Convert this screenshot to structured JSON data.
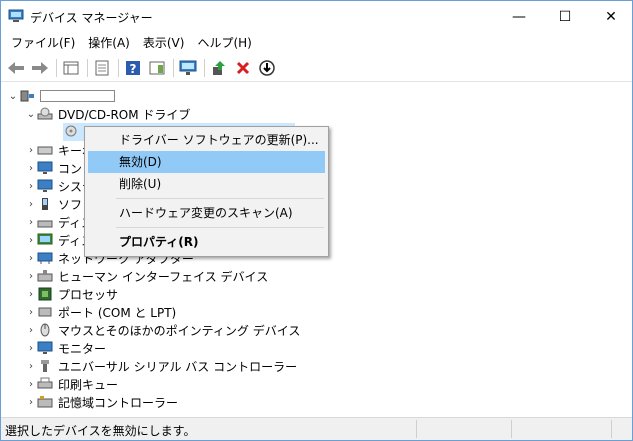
{
  "window": {
    "title": "デバイス マネージャー"
  },
  "window_buttons": {
    "minimize": "—",
    "maximize": "☐",
    "close": "✕"
  },
  "menu": [
    "ファイル(F)",
    "操作(A)",
    "表示(V)",
    "ヘルプ(H)"
  ],
  "tree": {
    "computer_name": "",
    "dvd_category": "DVD/CD-ROM ドライブ",
    "dvd_child": "",
    "categories": [
      "キーボード",
      "コンピューター",
      "システム デバイス",
      "ソフトウェア デバイス",
      "ディスク ドライブ",
      "ディスプレイ アダプター",
      "ネットワーク アダプター",
      "ヒューマン インターフェイス デバイス",
      "プロセッサ",
      "ポート (COM と LPT)",
      "マウスとそのほかのポインティング デバイス",
      "モニター",
      "ユニバーサル シリアル バス コントローラー",
      "印刷キュー",
      "記憶域コントローラー"
    ]
  },
  "context_menu": {
    "update": "ドライバー ソフトウェアの更新(P)...",
    "disable": "無効(D)",
    "uninstall": "削除(U)",
    "scan": "ハードウェア変更のスキャン(A)",
    "properties": "プロパティ(R)"
  },
  "status": {
    "text": "選択したデバイスを無効にします。"
  },
  "colors": {
    "highlight": "#91c9f7",
    "selection": "#cce8ff",
    "border": "#6a9fd6"
  }
}
